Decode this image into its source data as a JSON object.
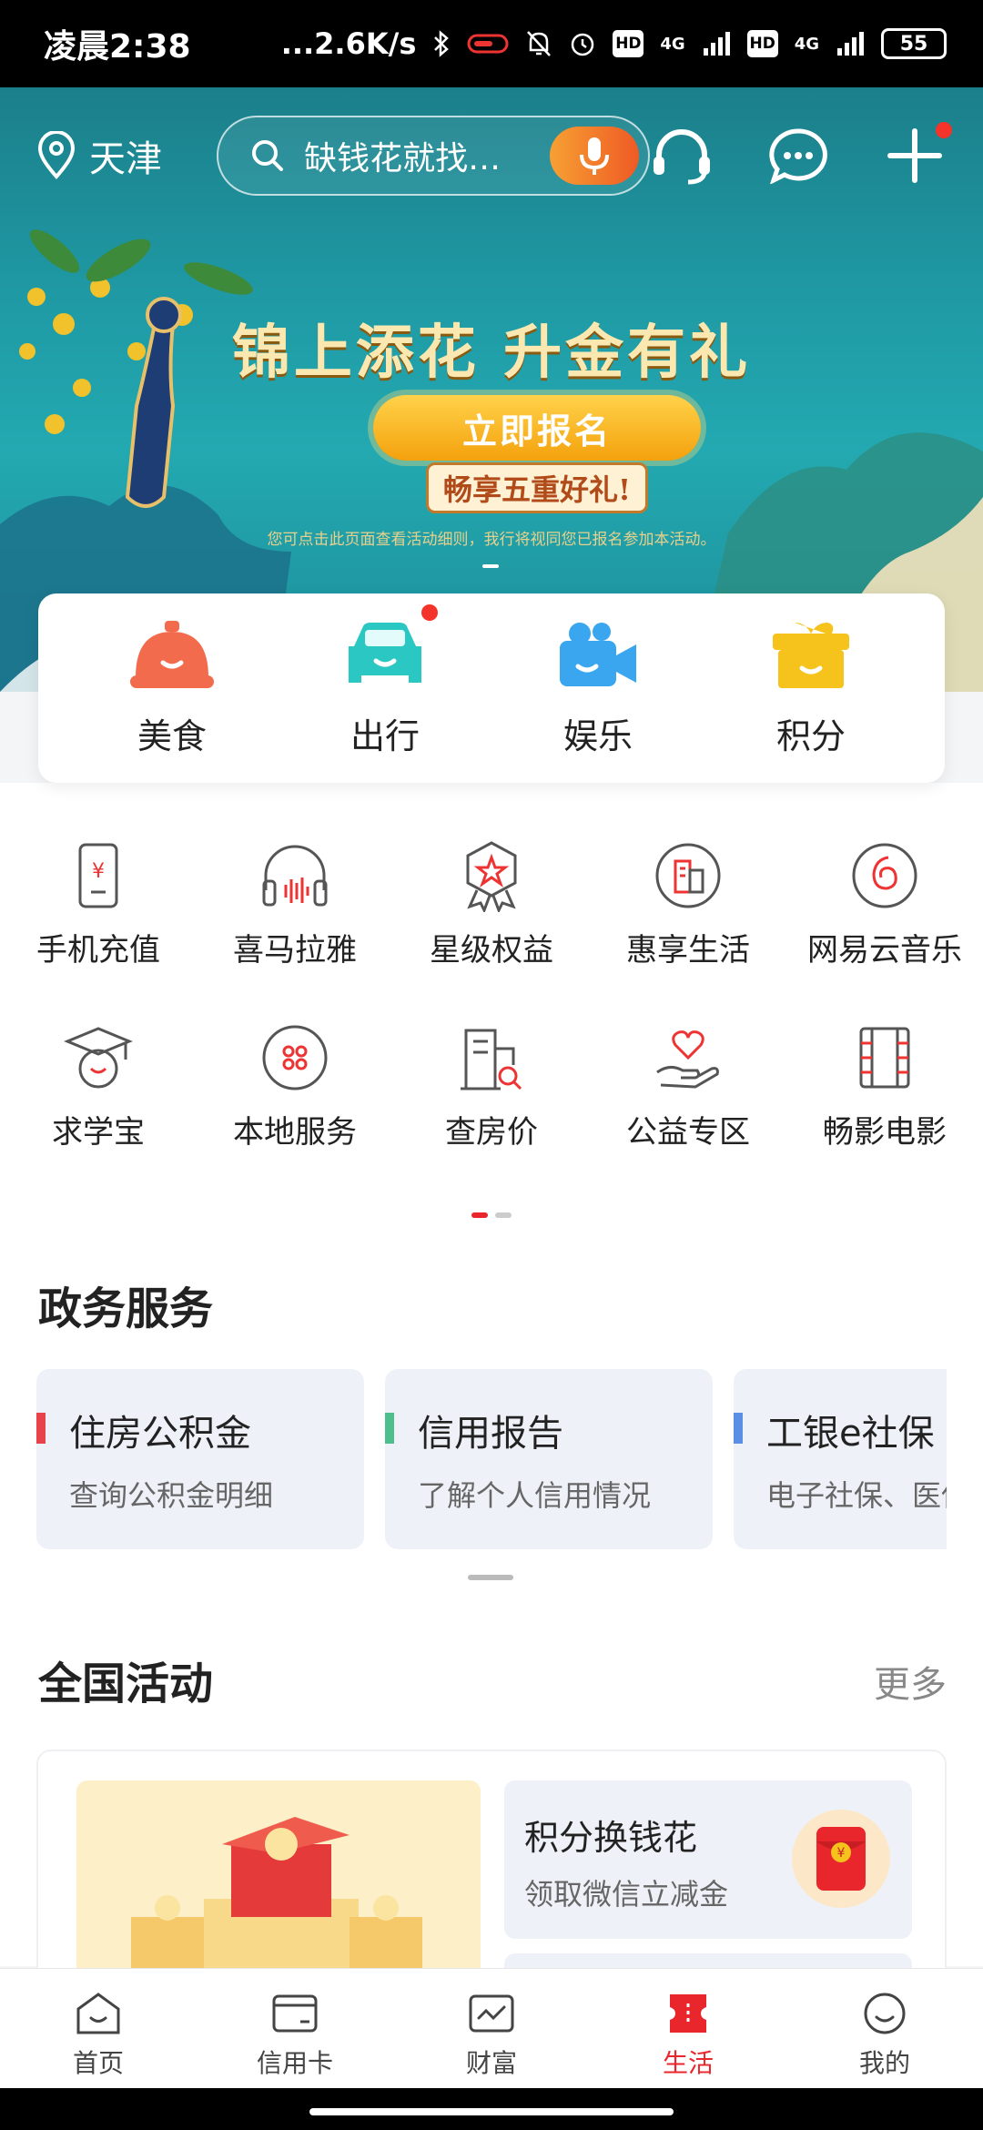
{
  "status_bar": {
    "time": "凌晨2:38",
    "speed": "...2.6K/s",
    "net1": "4G",
    "net2": "4G",
    "hd": "HD",
    "battery": "55"
  },
  "header": {
    "location": "天津",
    "search_placeholder": "缺钱花就找…"
  },
  "banner": {
    "title": "锦上添花 升金有礼",
    "button": "立即报名",
    "subtitle": "畅享五重好礼!",
    "note": "您可点击此页面查看活动细则，我行将视同您已报名参加本活动。"
  },
  "quick_entries": [
    {
      "label": "美食",
      "icon": "food-bell-icon",
      "color": "#f36b4d"
    },
    {
      "label": "出行",
      "icon": "car-icon",
      "color": "#2bc7c3",
      "dot": true
    },
    {
      "label": "娱乐",
      "icon": "video-camera-icon",
      "color": "#3aa6ef"
    },
    {
      "label": "积分",
      "icon": "gift-box-icon",
      "color": "#f6c21c"
    }
  ],
  "services_row1": [
    {
      "label": "手机充值",
      "icon": "phone-recharge-icon"
    },
    {
      "label": "喜马拉雅",
      "icon": "headphones-icon"
    },
    {
      "label": "星级权益",
      "icon": "star-badge-icon"
    },
    {
      "label": "惠享生活",
      "icon": "building-icon"
    },
    {
      "label": "网易云音乐",
      "icon": "music-disc-icon"
    }
  ],
  "services_row2": [
    {
      "label": "求学宝",
      "icon": "graduation-cap-icon"
    },
    {
      "label": "本地服务",
      "icon": "grid-circle-icon"
    },
    {
      "label": "查房价",
      "icon": "house-search-icon"
    },
    {
      "label": "公益专区",
      "icon": "heart-hand-icon"
    },
    {
      "label": "畅影电影",
      "icon": "film-strip-icon"
    }
  ],
  "gov": {
    "title": "政务服务",
    "cards": [
      {
        "title": "住房公积金",
        "sub": "查询公积金明细",
        "color": "#e8434b"
      },
      {
        "title": "信用报告",
        "sub": "了解个人信用情况",
        "color": "#4cbf8c"
      },
      {
        "title": "工银e社保",
        "sub": "电子社保、医保",
        "color": "#5b8fe6"
      }
    ]
  },
  "activity": {
    "title": "全国活动",
    "more": "更多",
    "card_title": "积分换钱花",
    "card_sub": "领取微信立减金"
  },
  "tabs": [
    {
      "label": "首页",
      "icon": "home-face-icon"
    },
    {
      "label": "信用卡",
      "icon": "credit-card-icon"
    },
    {
      "label": "财富",
      "icon": "wealth-chart-icon"
    },
    {
      "label": "生活",
      "icon": "life-ticket-icon",
      "active": true
    },
    {
      "label": "我的",
      "icon": "profile-face-icon"
    }
  ],
  "colors": {
    "brand_red": "#e8262c",
    "teal": "#1f9aa5"
  }
}
